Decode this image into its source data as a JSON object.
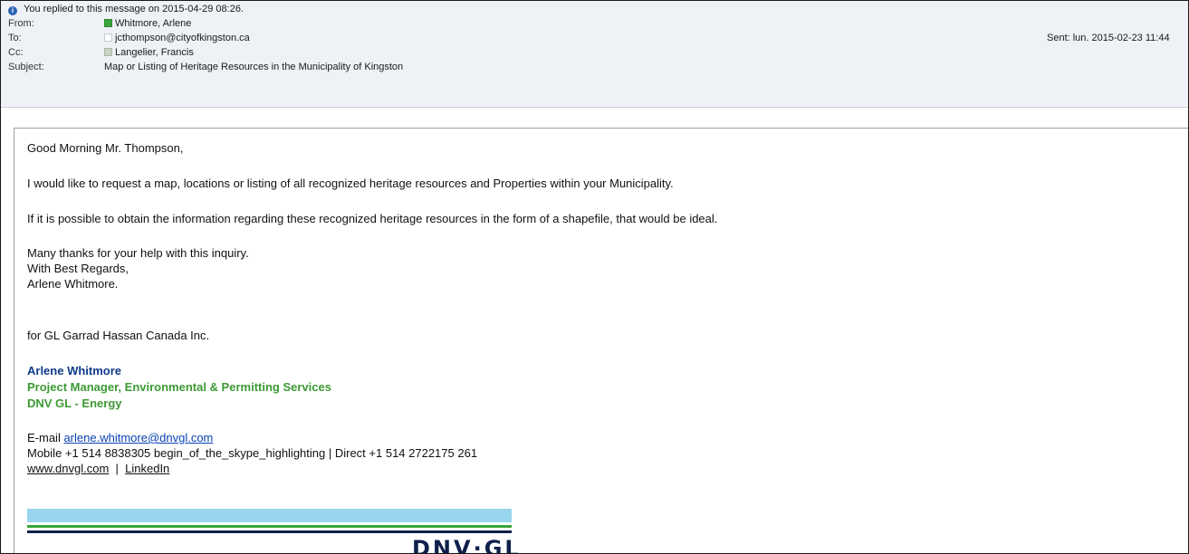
{
  "header": {
    "info": "You replied to this message on 2015-04-29 08:26.",
    "from_label": "From:",
    "from_value": "Whitmore, Arlene",
    "to_label": "To:",
    "to_value": "jcthompson@cityofkingston.ca",
    "cc_label": "Cc:",
    "cc_value": "Langelier, Francis",
    "subject_label": "Subject:",
    "subject_value": "Map or Listing of Heritage Resources in the Municipality of Kingston",
    "sent": "Sent:  lun. 2015-02-23 11:44"
  },
  "body": {
    "greeting": "Good Morning Mr. Thompson,",
    "p1": "I would like to request a map, locations or listing of all recognized heritage resources and Properties within your Municipality.",
    "p2": "If it is possible to obtain the information regarding these recognized heritage resources in the form of a shapefile, that would be ideal.",
    "thanks": "Many thanks for your help with this inquiry.",
    "regards": "With Best Regards,",
    "signoff": "Arlene Whitmore.",
    "company_line": "for GL Garrad Hassan Canada Inc."
  },
  "signature": {
    "name": "Arlene Whitmore",
    "title": "Project Manager, Environmental & Permitting Services",
    "division": "DNV GL - Energy",
    "email_label": "E-mail ",
    "email": "arlene.whitmore@dnvgl.com",
    "phones": "Mobile +1 514 8838305   begin_of_the_skype_highlighting  |  Direct +1 514 2722175 261",
    "website": "www.dnvgl.com",
    "separator": "  |  ",
    "linkedin": "LinkedIn",
    "logo_text": "DNV·GL"
  },
  "colors": {
    "header_bg": "#eef1f5",
    "signature_blue": "#0f3a8a",
    "signature_green": "#3c9a34",
    "link": "#0a42b5",
    "logo_light_blue": "#99d5ee",
    "logo_green": "#3aa53a",
    "logo_navy": "#0f204b"
  },
  "icons": {
    "info": "info-icon",
    "from_status": "presence-green-icon",
    "to_status": "presence-empty-icon",
    "cc_status": "presence-gray-icon"
  }
}
